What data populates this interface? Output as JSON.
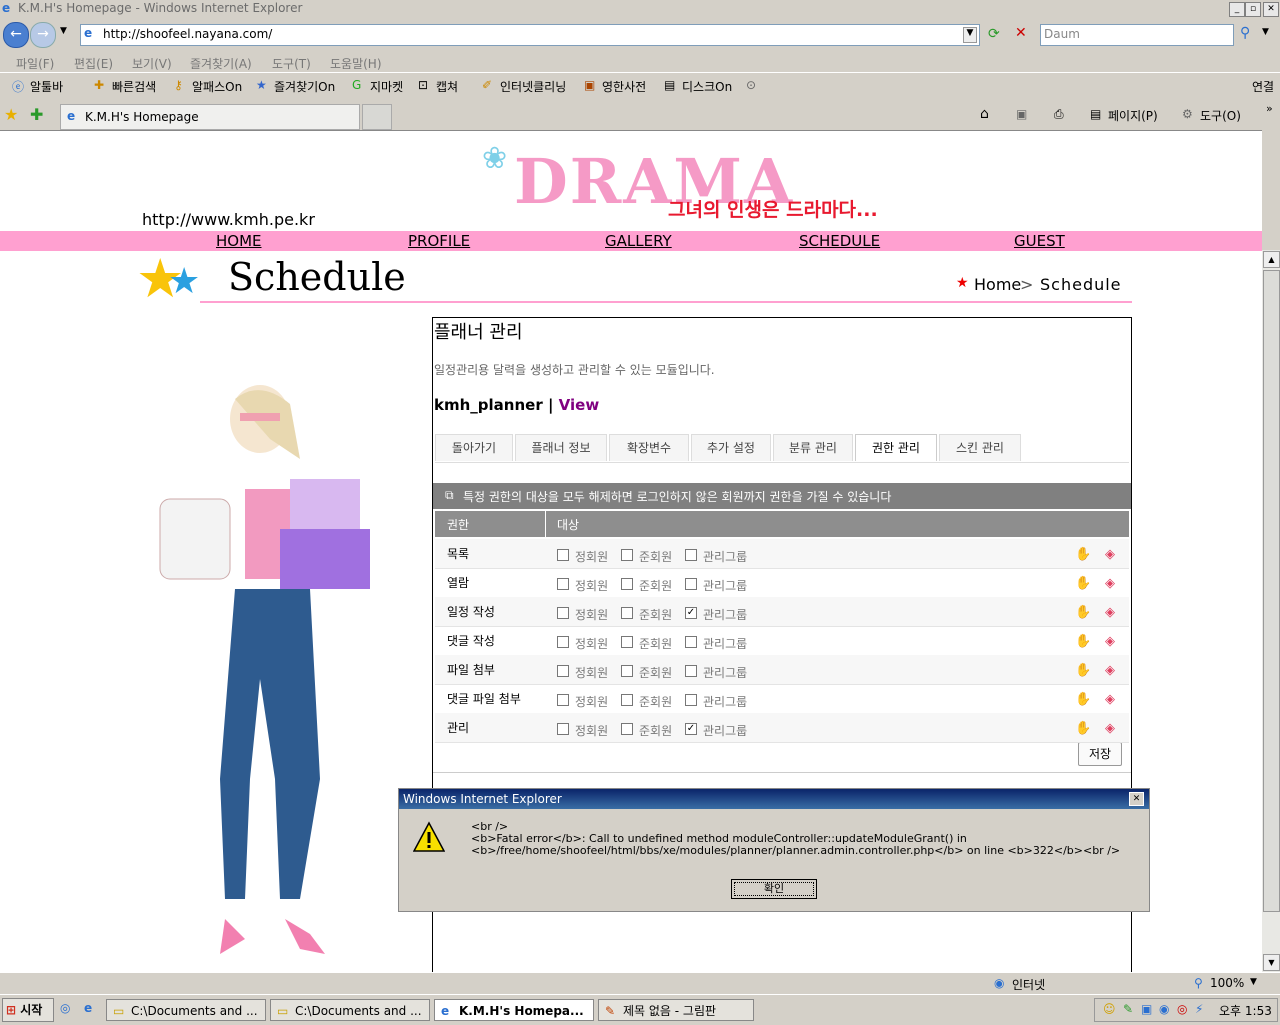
{
  "window": {
    "title": "K.M.H's Homepage - Windows Internet Explorer"
  },
  "browser": {
    "url": "http://shoofeel.nayana.com/",
    "search_placeholder": "Daum",
    "menu": [
      "파일(F)",
      "편집(E)",
      "보기(V)",
      "즐겨찾기(A)",
      "도구(T)",
      "도움말(H)"
    ],
    "links": [
      "알툴바",
      "빠른검색",
      "알패스On",
      "즐겨찾기On",
      "지마켓",
      "캡쳐",
      "인터넷클리닝",
      "영한사전",
      "디스크On"
    ],
    "links_right": "연결",
    "tab_title": "K.M.H's Homepage",
    "cmd": {
      "page": "페이지(P)",
      "tools": "도구(O)"
    }
  },
  "site": {
    "logo": "DRAMA",
    "slogan": "그녀의 인생은 드라마다...",
    "home_url": "http://www.kmh.pe.kr",
    "nav": [
      "HOME",
      "PROFILE",
      "GALLERY",
      "SCHEDULE",
      "GUEST"
    ],
    "section_title": "Schedule",
    "breadcrumb": {
      "home": "Home",
      "current": "Schedule"
    }
  },
  "admin": {
    "title": "플래너 관리",
    "description": "일정관리용 달력을 생성하고 관리할 수 있는 모듈입니다.",
    "module_name": "kmh_planner",
    "sep": "|",
    "view_link": "View",
    "tabs": [
      "돌아가기",
      "플래너 정보",
      "확장변수",
      "추가 설정",
      "분류 관리",
      "권한 관리",
      "스킨 관리"
    ],
    "active_tab": 5,
    "notice": "특정 권한의 대상을 모두 해제하면 로그인하지 않은 회원까지 권한을 가질 수 있습니다",
    "columns": [
      "권한",
      "대상"
    ],
    "groups": [
      "정회원",
      "준회원",
      "관리그룹"
    ],
    "rows": [
      {
        "label": "목록",
        "checks": [
          false,
          false,
          false
        ]
      },
      {
        "label": "열람",
        "checks": [
          false,
          false,
          false
        ]
      },
      {
        "label": "일정 작성",
        "checks": [
          false,
          false,
          true
        ]
      },
      {
        "label": "댓글 작성",
        "checks": [
          false,
          false,
          false
        ]
      },
      {
        "label": "파일 첨부",
        "checks": [
          false,
          false,
          false
        ]
      },
      {
        "label": "댓글 파일 첨부",
        "checks": [
          false,
          false,
          false
        ]
      },
      {
        "label": "관리",
        "checks": [
          false,
          false,
          true
        ]
      }
    ],
    "save_label": "저장"
  },
  "dialog": {
    "title": "Windows Internet Explorer",
    "line1": "<br />",
    "line2": "<b>Fatal error</b>:  Call to undefined method moduleController::updateModuleGrant() in",
    "line3": "<b>/free/home/shoofeel/html/bbs/xe/modules/planner/planner.admin.controller.php</b> on line <b>322</b><br />",
    "ok_label": "확인"
  },
  "statusbar": {
    "zone": "인터넷",
    "zoom": "100%"
  },
  "taskbar": {
    "start": "시작",
    "tasks": [
      "C:\\Documents and ...",
      "C:\\Documents and ...",
      "K.M.H's Homepa...",
      "제목 없음 - 그림판"
    ],
    "clock": "오후 1:53"
  },
  "colors": {
    "pink": "#ffa0d0",
    "link_purple": "#800080",
    "header_gray": "#808080"
  }
}
